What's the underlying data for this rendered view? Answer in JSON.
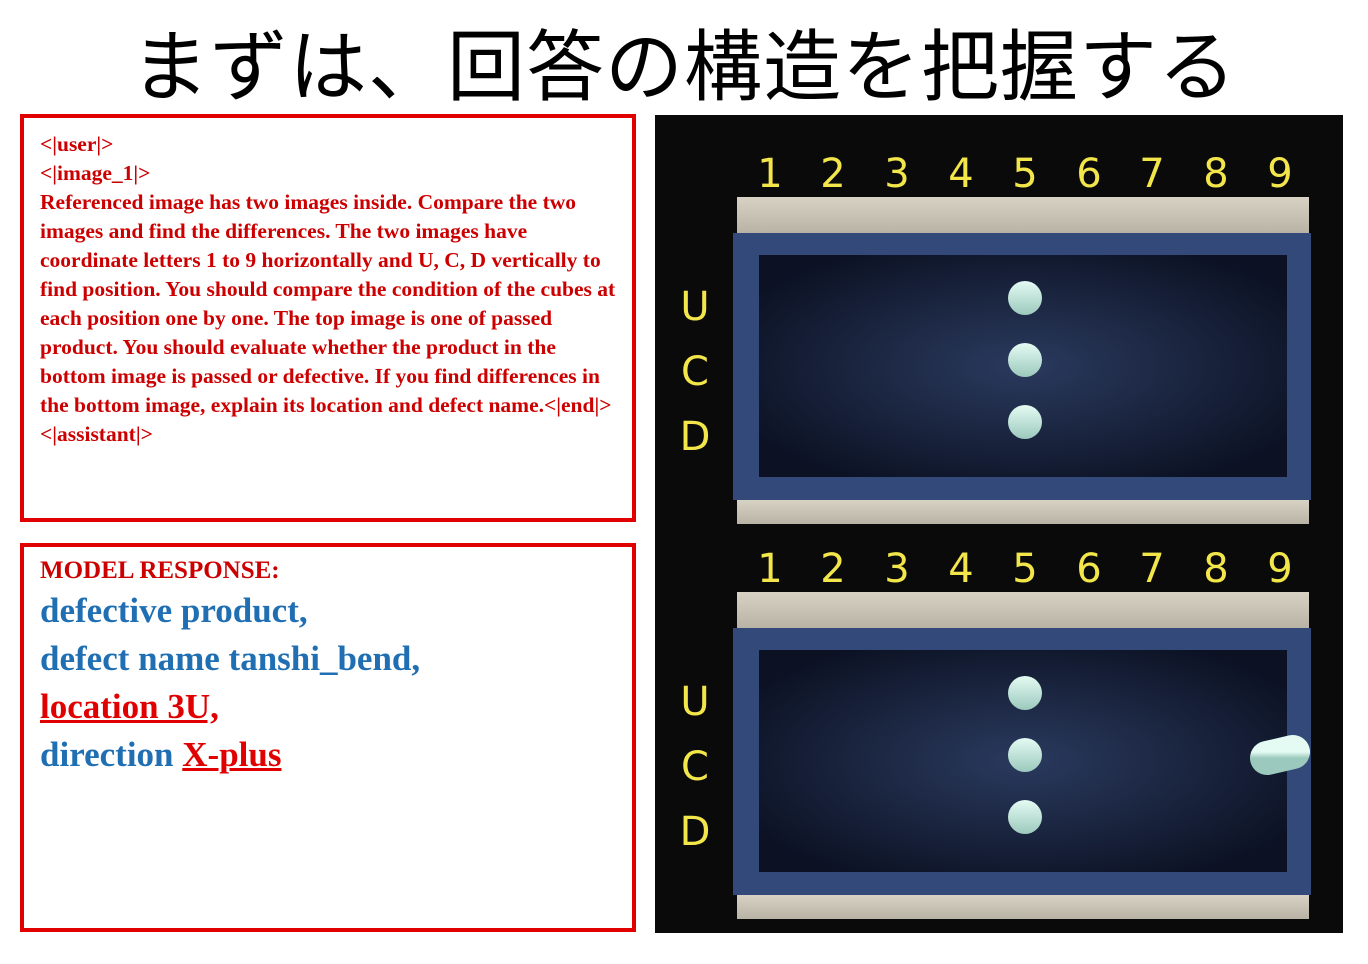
{
  "title": "まずは、回答の構造を把握する",
  "prompt": {
    "text": "<|user|>\n<|image_1|>\nReferenced image has two images inside. Compare the two images and find the differences. The two images have coordinate letters 1 to 9 horizontally and U, C, D vertically to find position. You should compare the condition of the cubes at each position one by one. The top image is one of passed product. You should evaluate whether the product in the bottom image is passed or defective. If you find differences in the bottom image, explain its location and defect name.<|end|>\n<|assistant|>"
  },
  "response": {
    "label": "MODEL RESPONSE:",
    "line1": "defective product,",
    "line2": "defect name tanshi_bend,",
    "line3": "location 3U,",
    "line4_prefix": "direction ",
    "line4_value": "X-plus"
  },
  "images": {
    "columns": [
      "1",
      "2",
      "3",
      "4",
      "5",
      "6",
      "7",
      "8",
      "9"
    ],
    "rows": [
      "U",
      "C",
      "D"
    ],
    "label_color": "#f2e64a",
    "frame_color": "#33497a",
    "pin_color": "#c6ece2"
  }
}
